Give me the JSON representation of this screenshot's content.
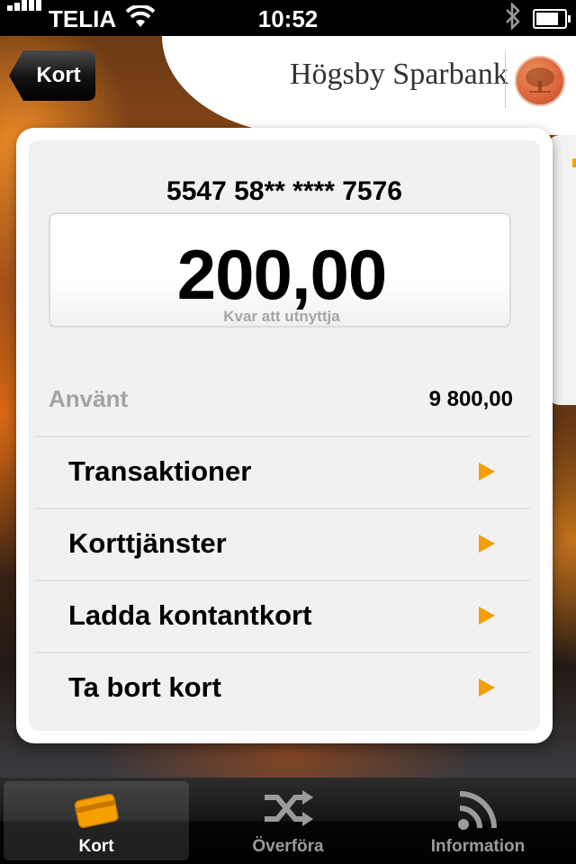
{
  "status_bar": {
    "carrier": "TELIA",
    "time": "10:52"
  },
  "header": {
    "back_label": "Kort",
    "bank_name": "Högsby Sparbank"
  },
  "card": {
    "number": "5547 58** **** 7576",
    "balance": "200,00",
    "balance_label": "Kvar att utnyttja",
    "used_label": "Använt",
    "used_value": "9 800,00"
  },
  "menu": {
    "items": [
      {
        "label": "Transaktioner"
      },
      {
        "label": "Korttjänster"
      },
      {
        "label": "Ladda kontantkort"
      },
      {
        "label": "Ta bort kort"
      }
    ]
  },
  "tabs": [
    {
      "label": "Kort",
      "icon": "card-icon",
      "active": true
    },
    {
      "label": "Överföra",
      "icon": "shuffle-icon",
      "active": false
    },
    {
      "label": "Information",
      "icon": "rss-icon",
      "active": false
    }
  ],
  "colors": {
    "accent": "#f5a000",
    "logo": "#d9623a"
  }
}
